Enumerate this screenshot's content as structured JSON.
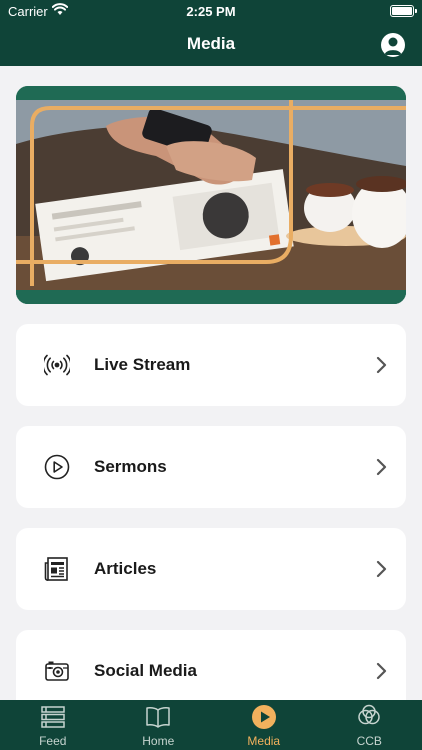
{
  "status_bar": {
    "carrier": "Carrier",
    "time": "2:25 PM"
  },
  "header": {
    "title": "Media",
    "profile_icon": "person-icon"
  },
  "hero": {
    "image": "phone-magazine-coffee-photo"
  },
  "menu": [
    {
      "label": "Live Stream",
      "icon": "broadcast-icon"
    },
    {
      "label": "Sermons",
      "icon": "play-circle-icon"
    },
    {
      "label": "Articles",
      "icon": "newspaper-icon"
    },
    {
      "label": "Social Media",
      "icon": "camera-icon"
    }
  ],
  "tabs": [
    {
      "label": "Feed",
      "icon": "list-icon"
    },
    {
      "label": "Home",
      "icon": "book-icon"
    },
    {
      "label": "Media",
      "icon": "play-icon",
      "active": true
    },
    {
      "label": "CCB",
      "icon": "circles-icon"
    }
  ],
  "colors": {
    "brand": "#0f4438",
    "accent": "#f2b15d",
    "background": "#f2f2f4"
  }
}
